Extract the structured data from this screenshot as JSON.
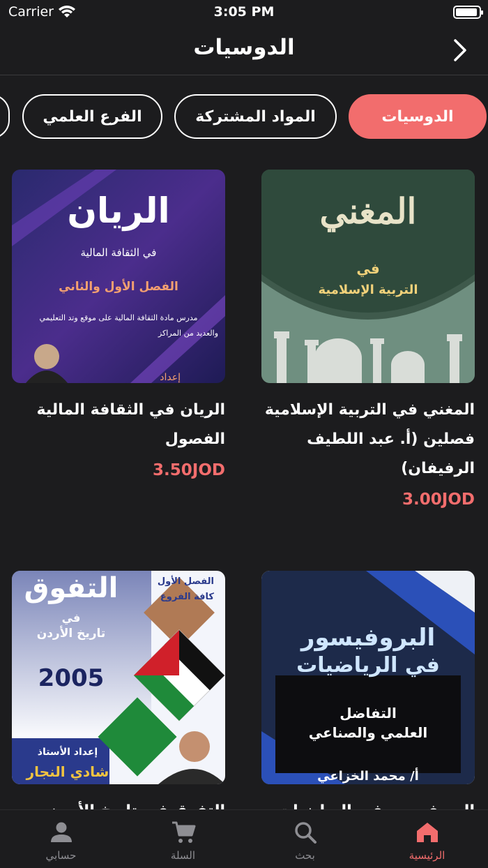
{
  "status": {
    "carrier": "Carrier",
    "time": "3:05 PM"
  },
  "nav": {
    "title": "الدوسيات"
  },
  "chips": [
    {
      "label": "الدوسيات"
    },
    {
      "label": "المواد المشتركة"
    },
    {
      "label": "الفرع العلمي"
    }
  ],
  "books": [
    {
      "title": "المغني في التربية الإسلامية فصلين (أ. عبد اللطيف الرفيفان)",
      "price": "3.00JOD",
      "cover_lines": {
        "main": "المغني",
        "sub1": "في",
        "sub2": "التربية الإسلامية"
      }
    },
    {
      "title": "الريان في الثقافة المالية الفصول",
      "price": "3.50JOD",
      "cover_lines": {
        "main": "الريان",
        "sub1": "في الثقافة المالية",
        "sub2": "الفصل الأول والثاني",
        "sub3": "مدرس مادة الثقافة المالية على موقع وتد التعليمي",
        "sub4": "والعديد من المراكز",
        "author": "إعداد"
      }
    },
    {
      "title": "البروفيسور في الرياضيات",
      "cover_lines": {
        "main": "البروفيسور",
        "sub1": "في الرياضيات",
        "sub2": "التفاضل",
        "sub3": "العلمي والصناعي",
        "author": "أ/ محمد الخزاعي"
      }
    },
    {
      "title": "التفوق في تاريخ الأردن",
      "cover_lines": {
        "main": "التفوق",
        "sub1": "في",
        "sub2": "تاريخ الأردن",
        "year": "2005",
        "tag1": "الفصل الأول",
        "tag2": "كافة الفروع",
        "by": "إعداد الأستاذ",
        "author": "شادي النجار"
      }
    }
  ],
  "tabs": [
    {
      "label": "الرئيسية",
      "icon": "home-icon"
    },
    {
      "label": "بحث",
      "icon": "search-icon"
    },
    {
      "label": "السلة",
      "icon": "cart-icon"
    },
    {
      "label": "حسابي",
      "icon": "person-icon"
    }
  ],
  "colors": {
    "accent": "#f26d6d",
    "background": "#1c1c1e",
    "inactive": "#8e8e93"
  }
}
